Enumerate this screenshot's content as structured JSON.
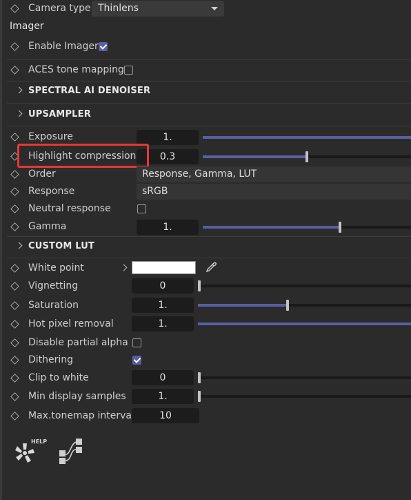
{
  "camera": {
    "label": "Camera type",
    "value": "Thinlens"
  },
  "imager": {
    "title": "Imager"
  },
  "enable_imager": {
    "label": "Enable Imager",
    "checked": true
  },
  "aces": {
    "label": "ACES tone mapping",
    "checked": false
  },
  "groups": {
    "denoiser": "SPECTRAL AI DENOISER",
    "upsampler": "UPSAMPLER",
    "custom_lut": "CUSTOM LUT"
  },
  "exposure": {
    "label": "Exposure",
    "value": "1.",
    "level": 1.0
  },
  "highlight": {
    "label": "Highlight compression",
    "value": "0.3",
    "level": 0.5
  },
  "order": {
    "label": "Order",
    "value": "Response, Gamma, LUT"
  },
  "response": {
    "label": "Response",
    "value": "sRGB"
  },
  "neutral": {
    "label": "Neutral response",
    "checked": false
  },
  "gamma": {
    "label": "Gamma",
    "value": "1.",
    "level": 0.66
  },
  "white_point": {
    "label": "White point",
    "color": "#ffffff"
  },
  "vignetting": {
    "label": "Vignetting",
    "value": "0",
    "level": 0.0
  },
  "saturation": {
    "label": "Saturation",
    "value": "1.",
    "level": 0.42
  },
  "hot_pixel": {
    "label": "Hot pixel removal",
    "value": "1.",
    "level": 1.0
  },
  "partial_alpha": {
    "label": "Disable partial alpha",
    "checked": false
  },
  "dithering": {
    "label": "Dithering",
    "checked": true
  },
  "clip_white": {
    "label": "Clip to white",
    "value": "0",
    "level": 0.0
  },
  "min_samples": {
    "label": "Min display samples",
    "value": "1.",
    "level": 0.0
  },
  "max_interval": {
    "label": "Max.tonemap interval",
    "value": "10"
  },
  "footer": {
    "help_badge": "HELP"
  },
  "accent_color": "#5a5ea3",
  "highlight_color": "#e53935"
}
